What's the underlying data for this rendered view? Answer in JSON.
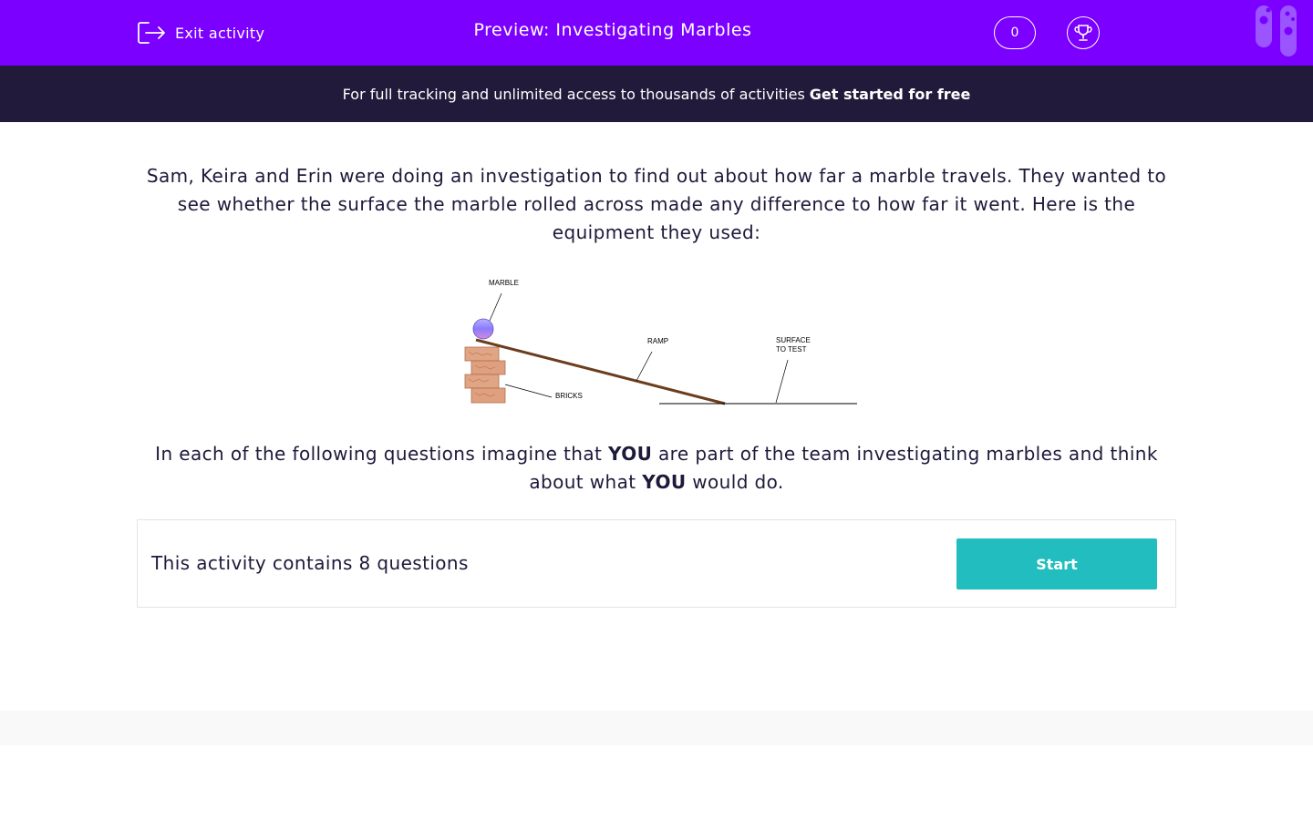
{
  "header": {
    "exit_label": "Exit activity",
    "title": "Preview: Investigating Marbles",
    "score": "0"
  },
  "promo": {
    "text": "For full tracking and unlimited access to thousands of activities",
    "link": "Get started for free"
  },
  "intro": {
    "text": "Sam, Keira and Erin were doing an investigation to find out about how far a marble travels. They wanted to see whether the surface the marble rolled across made any difference to how far it went. Here is the equipment they used:"
  },
  "diagram": {
    "labels": {
      "marble": "MARBLE",
      "ramp": "RAMP",
      "surface_line1": "SURFACE",
      "surface_line2": "TO TEST",
      "bricks": "BRICKS"
    }
  },
  "task": {
    "part1": "In each of the following questions imagine that",
    "you1": "YOU",
    "part2": "are part of the team investigating marbles and think about what",
    "you2": "YOU",
    "part3": "would do."
  },
  "card": {
    "count_text": "This activity contains 8 questions",
    "start_label": "Start"
  },
  "icons": {
    "exit": "exit-icon",
    "trophy": "trophy-icon",
    "tubes": "test-tubes-logo-icon"
  },
  "colors": {
    "header_bg": "#7b00ff",
    "promo_bg": "#221a3a",
    "start_button": "#22bdbe",
    "text": "#1d1a3a"
  }
}
